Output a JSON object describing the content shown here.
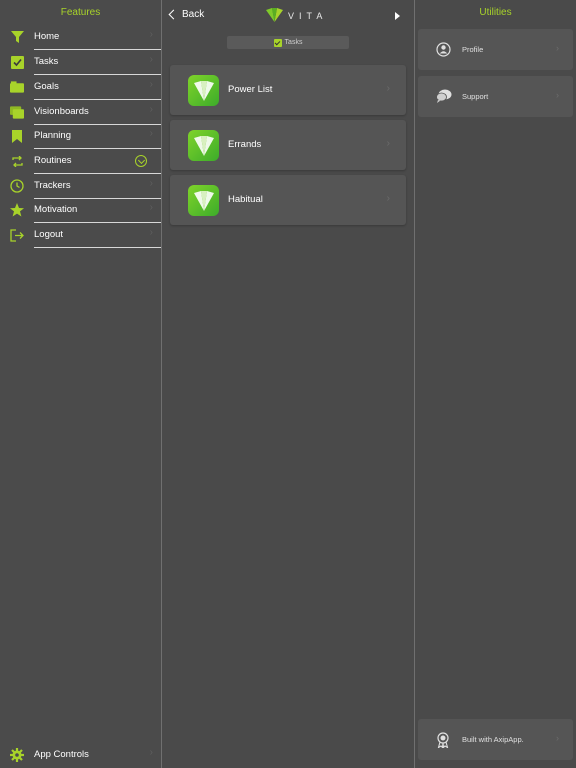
{
  "colors": {
    "accent": "#a8d32a",
    "background": "#4a4a4a",
    "card": "#555555"
  },
  "features": {
    "title": "Features",
    "items": [
      {
        "label": "Home",
        "icon": "funnel-icon"
      },
      {
        "label": "Tasks",
        "icon": "checkbox-icon"
      },
      {
        "label": "Goals",
        "icon": "folder-icon"
      },
      {
        "label": "Visionboards",
        "icon": "stacked-folders-icon"
      },
      {
        "label": "Planning",
        "icon": "bookmark-icon"
      },
      {
        "label": "Routines",
        "icon": "repeat-icon"
      },
      {
        "label": "Trackers",
        "icon": "timer-icon"
      },
      {
        "label": "Motivation",
        "icon": "star-icon"
      },
      {
        "label": "Logout",
        "icon": "logout-icon"
      }
    ],
    "app_controls": {
      "label": "App Controls",
      "icon": "gear-icon"
    }
  },
  "center": {
    "back_label": "Back",
    "brand": "VITA",
    "section_tag": "Tasks",
    "cards": [
      {
        "label": "Power List"
      },
      {
        "label": "Errands"
      },
      {
        "label": "Habitual"
      }
    ]
  },
  "utilities": {
    "title": "Utilities",
    "items": [
      {
        "label": "Profile",
        "icon": "user-icon"
      },
      {
        "label": "Support",
        "icon": "chat-icon"
      }
    ],
    "footer": {
      "label": "Built with AxipApp.",
      "icon": "award-icon"
    }
  }
}
